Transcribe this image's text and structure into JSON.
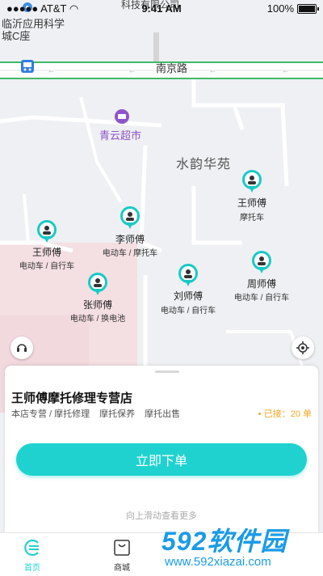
{
  "status_bar": {
    "carrier": "AT&T",
    "time": "9:41 AM",
    "battery": "100%"
  },
  "map": {
    "top_partial_label": "科技有限公司",
    "poi_top_left": "临沂应用科学城C座",
    "road_name": "南京路",
    "supermarket": "青云超市",
    "area_name": "水韵华苑"
  },
  "workers": [
    {
      "name": "王师傅",
      "type": "摩托车"
    },
    {
      "name": "李师傅",
      "type": "电动车 / 摩托车"
    },
    {
      "name": "王师傅",
      "type": "电动车 / 自行车"
    },
    {
      "name": "周师傅",
      "type": "电动车 / 自行车"
    },
    {
      "name": "刘师傅",
      "type": "电动车 / 自行车"
    },
    {
      "name": "张师傅",
      "type": "电动车 / 换电池"
    }
  ],
  "panel": {
    "title": "王师傅摩托修理专营店",
    "tags": [
      "本店专营 / 摩托修理",
      "摩托保养",
      "摩托出售"
    ],
    "orders": "• 已接：20 单",
    "order_button": "立即下单",
    "hint": "向上滑动查看更多"
  },
  "tabs": [
    {
      "label": "首页",
      "icon": "home-logo-icon",
      "active": true
    },
    {
      "label": "商城",
      "icon": "shopping-bag-icon",
      "active": false
    }
  ],
  "watermark": {
    "big": "592软件园",
    "small": "www.592xiazai.com"
  },
  "colors": {
    "accent": "#1fd2cf",
    "orders": "#f5a623",
    "road_green": "#3fb96a"
  }
}
